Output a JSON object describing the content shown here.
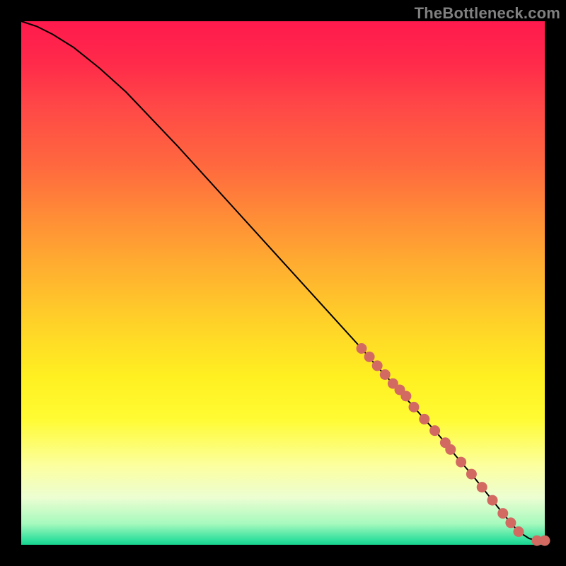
{
  "watermark": "TheBottleneck.com",
  "chart_data": {
    "type": "line",
    "title": "",
    "xlabel": "",
    "ylabel": "",
    "xlim": [
      0,
      100
    ],
    "ylim": [
      0,
      100
    ],
    "grid": false,
    "legend": false,
    "annotations": [],
    "series": [
      {
        "name": "curve",
        "style": "line",
        "color": "#000000",
        "x": [
          0,
          3,
          6,
          10,
          15,
          20,
          30,
          40,
          50,
          60,
          65,
          68,
          71,
          73,
          75,
          77,
          79,
          81,
          82,
          84,
          86,
          88,
          90,
          92,
          93.5,
          95,
          97,
          98.5,
          100
        ],
        "values": [
          100,
          99,
          97.5,
          95,
          91,
          86.5,
          76,
          65,
          54,
          43,
          37.5,
          34,
          30.8,
          28.5,
          26.3,
          24,
          21.8,
          19.5,
          18.2,
          15.8,
          13.5,
          11,
          8.5,
          6,
          4.2,
          2.5,
          1.2,
          0.8,
          0.8
        ]
      },
      {
        "name": "points",
        "style": "scatter",
        "color": "#d26a62",
        "x": [
          65,
          66.5,
          68,
          69.5,
          71,
          72.3,
          73.5,
          75,
          77,
          79,
          81,
          82,
          84,
          86,
          88,
          90,
          92,
          93.5,
          95,
          98.5,
          100
        ],
        "values": [
          37.5,
          35.9,
          34.2,
          32.5,
          30.8,
          29.6,
          28.4,
          26.3,
          24,
          21.8,
          19.5,
          18.2,
          15.8,
          13.5,
          11,
          8.5,
          6,
          4.2,
          2.5,
          0.8,
          0.8
        ]
      }
    ]
  }
}
